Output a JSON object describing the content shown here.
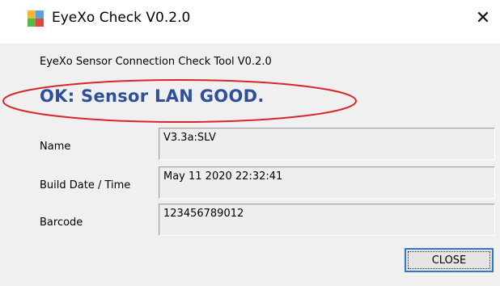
{
  "window": {
    "title": "EyeXo Check V0.2.0",
    "close_glyph": "✕"
  },
  "subtitle": "EyeXo Sensor Connection Check Tool V0.2.0",
  "status": {
    "text": "OK: Sensor LAN GOOD.",
    "color": "#2e4f9c",
    "highlight_color": "#d9262b"
  },
  "fields": {
    "name": {
      "label": "Name",
      "value": "V3.3a:SLV"
    },
    "build_date": {
      "label": "Build Date / Time",
      "value": "May 11 2020 22:32:41"
    },
    "barcode": {
      "label": "Barcode",
      "value": "123456789012"
    }
  },
  "buttons": {
    "close_label": "CLOSE"
  },
  "icons": {
    "app_icon": "app-icon",
    "close": "close-icon"
  }
}
